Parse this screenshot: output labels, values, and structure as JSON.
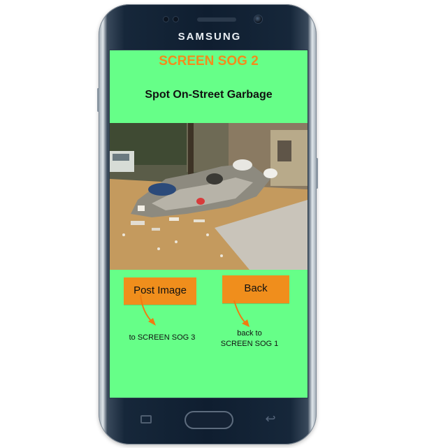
{
  "device": {
    "brand": "SAMSUNG"
  },
  "screen": {
    "title": "SCREEN SOG 2",
    "subtitle": "Spot On-Street Garbage",
    "image_alt": "garbage-pile-on-street-photo",
    "buttons": {
      "post_image": "Post Image",
      "back": "Back"
    },
    "notes": {
      "post_image_target": "to SCREEN SOG 3",
      "back_target_line1": "back to",
      "back_target_line2": "SCREEN SOG 1"
    }
  },
  "colors": {
    "screen_bg": "#66ff88",
    "title": "#f28c1c",
    "button": "#f08e1c",
    "annotation_arrow": "#f07a10"
  },
  "icons": {
    "nav_recents": "recents-icon",
    "nav_home": "home-button",
    "nav_back": "back-icon"
  }
}
